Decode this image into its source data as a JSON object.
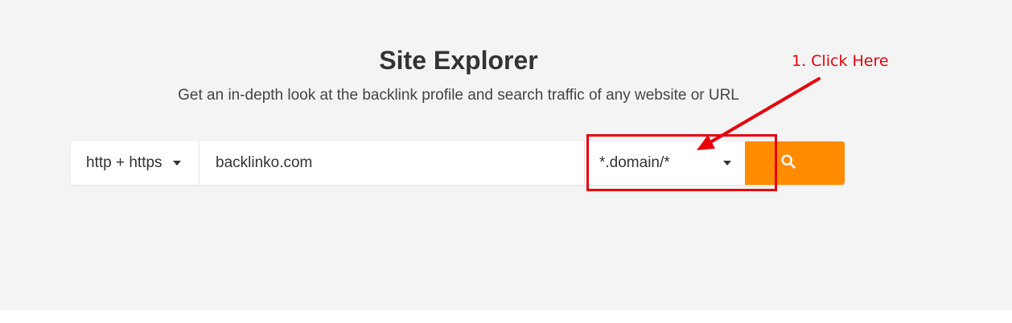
{
  "page": {
    "title": "Site Explorer",
    "subtitle": "Get an in-depth look at the backlink profile and search traffic of any website or URL"
  },
  "search": {
    "protocol": "http + https",
    "url_value": "backlinko.com",
    "mode": "*.domain/*",
    "button_icon": "search-icon"
  },
  "annotation": {
    "text": "1. Click Here",
    "color": "#e8000b"
  },
  "colors": {
    "accent": "#ff8c00",
    "background": "#f4f4f4"
  }
}
